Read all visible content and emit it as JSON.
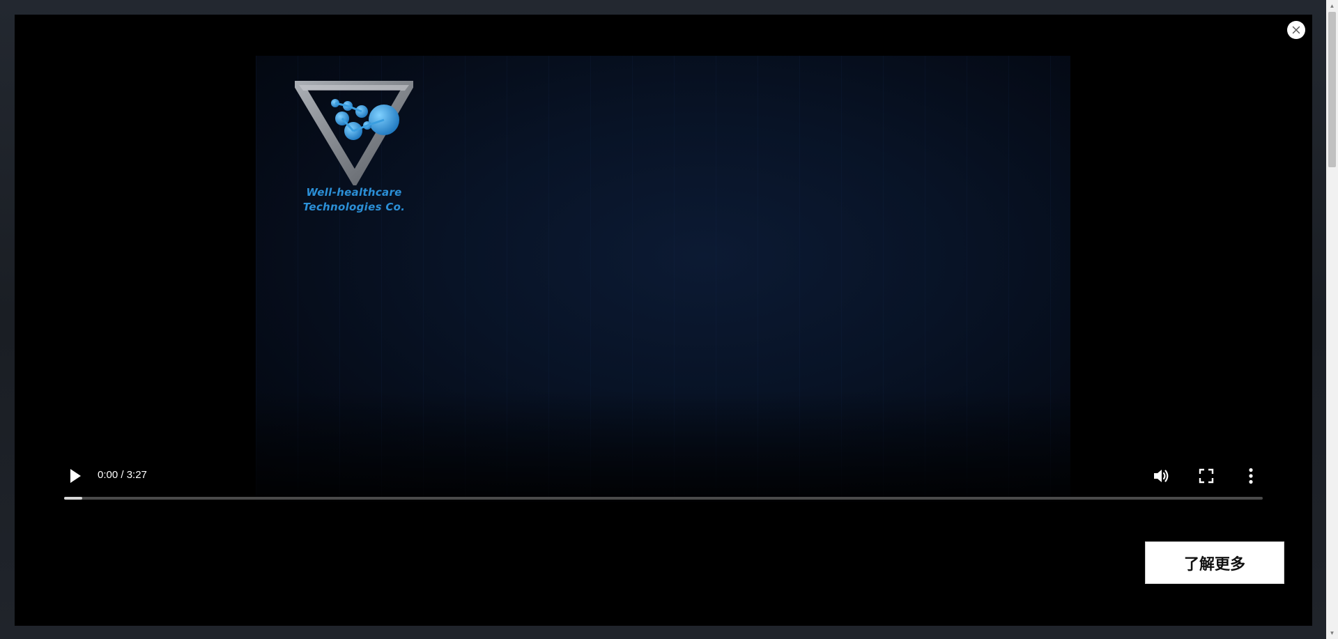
{
  "video": {
    "logo_line1": "Well-healthcare",
    "logo_line2": "Technologies Co.",
    "time_display": "0:00 / 3:27",
    "current_time": "0:00",
    "duration": "3:27",
    "progress_fraction": 0.015
  },
  "controls": {
    "play_icon": "play-icon",
    "volume_icon": "volume-icon",
    "fullscreen_icon": "fullscreen-icon",
    "more_icon": "more-vertical-icon"
  },
  "modal": {
    "close_icon": "close-icon",
    "cta_label": "了解更多"
  },
  "colors": {
    "logo_blue": "#2b8fd6",
    "modal_bg": "#000000",
    "button_bg": "#ffffff"
  }
}
